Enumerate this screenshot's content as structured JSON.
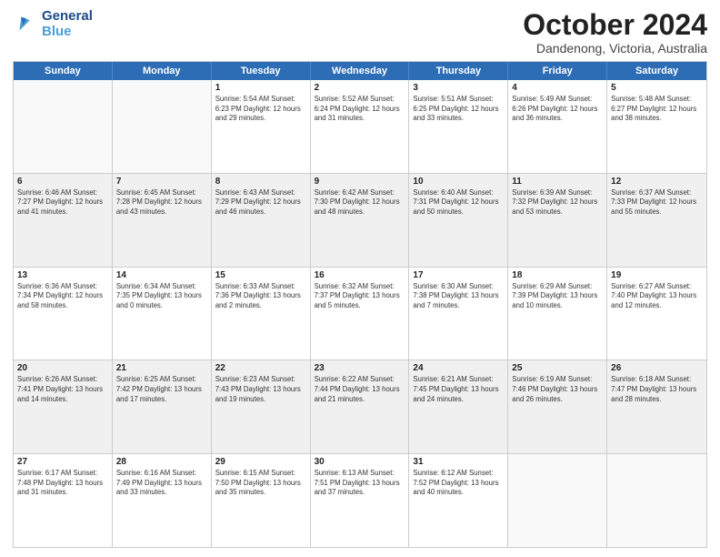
{
  "logo": {
    "line1": "General",
    "line2": "Blue"
  },
  "title": "October 2024",
  "location": "Dandenong, Victoria, Australia",
  "headers": [
    "Sunday",
    "Monday",
    "Tuesday",
    "Wednesday",
    "Thursday",
    "Friday",
    "Saturday"
  ],
  "rows": [
    [
      {
        "day": "",
        "detail": "",
        "empty": true
      },
      {
        "day": "",
        "detail": "",
        "empty": true
      },
      {
        "day": "1",
        "detail": "Sunrise: 5:54 AM\nSunset: 6:23 PM\nDaylight: 12 hours\nand 29 minutes."
      },
      {
        "day": "2",
        "detail": "Sunrise: 5:52 AM\nSunset: 6:24 PM\nDaylight: 12 hours\nand 31 minutes."
      },
      {
        "day": "3",
        "detail": "Sunrise: 5:51 AM\nSunset: 6:25 PM\nDaylight: 12 hours\nand 33 minutes."
      },
      {
        "day": "4",
        "detail": "Sunrise: 5:49 AM\nSunset: 6:26 PM\nDaylight: 12 hours\nand 36 minutes."
      },
      {
        "day": "5",
        "detail": "Sunrise: 5:48 AM\nSunset: 6:27 PM\nDaylight: 12 hours\nand 38 minutes."
      }
    ],
    [
      {
        "day": "6",
        "detail": "Sunrise: 6:46 AM\nSunset: 7:27 PM\nDaylight: 12 hours\nand 41 minutes."
      },
      {
        "day": "7",
        "detail": "Sunrise: 6:45 AM\nSunset: 7:28 PM\nDaylight: 12 hours\nand 43 minutes."
      },
      {
        "day": "8",
        "detail": "Sunrise: 6:43 AM\nSunset: 7:29 PM\nDaylight: 12 hours\nand 46 minutes."
      },
      {
        "day": "9",
        "detail": "Sunrise: 6:42 AM\nSunset: 7:30 PM\nDaylight: 12 hours\nand 48 minutes."
      },
      {
        "day": "10",
        "detail": "Sunrise: 6:40 AM\nSunset: 7:31 PM\nDaylight: 12 hours\nand 50 minutes."
      },
      {
        "day": "11",
        "detail": "Sunrise: 6:39 AM\nSunset: 7:32 PM\nDaylight: 12 hours\nand 53 minutes."
      },
      {
        "day": "12",
        "detail": "Sunrise: 6:37 AM\nSunset: 7:33 PM\nDaylight: 12 hours\nand 55 minutes."
      }
    ],
    [
      {
        "day": "13",
        "detail": "Sunrise: 6:36 AM\nSunset: 7:34 PM\nDaylight: 12 hours\nand 58 minutes."
      },
      {
        "day": "14",
        "detail": "Sunrise: 6:34 AM\nSunset: 7:35 PM\nDaylight: 13 hours\nand 0 minutes."
      },
      {
        "day": "15",
        "detail": "Sunrise: 6:33 AM\nSunset: 7:36 PM\nDaylight: 13 hours\nand 2 minutes."
      },
      {
        "day": "16",
        "detail": "Sunrise: 6:32 AM\nSunset: 7:37 PM\nDaylight: 13 hours\nand 5 minutes."
      },
      {
        "day": "17",
        "detail": "Sunrise: 6:30 AM\nSunset: 7:38 PM\nDaylight: 13 hours\nand 7 minutes."
      },
      {
        "day": "18",
        "detail": "Sunrise: 6:29 AM\nSunset: 7:39 PM\nDaylight: 13 hours\nand 10 minutes."
      },
      {
        "day": "19",
        "detail": "Sunrise: 6:27 AM\nSunset: 7:40 PM\nDaylight: 13 hours\nand 12 minutes."
      }
    ],
    [
      {
        "day": "20",
        "detail": "Sunrise: 6:26 AM\nSunset: 7:41 PM\nDaylight: 13 hours\nand 14 minutes."
      },
      {
        "day": "21",
        "detail": "Sunrise: 6:25 AM\nSunset: 7:42 PM\nDaylight: 13 hours\nand 17 minutes."
      },
      {
        "day": "22",
        "detail": "Sunrise: 6:23 AM\nSunset: 7:43 PM\nDaylight: 13 hours\nand 19 minutes."
      },
      {
        "day": "23",
        "detail": "Sunrise: 6:22 AM\nSunset: 7:44 PM\nDaylight: 13 hours\nand 21 minutes."
      },
      {
        "day": "24",
        "detail": "Sunrise: 6:21 AM\nSunset: 7:45 PM\nDaylight: 13 hours\nand 24 minutes."
      },
      {
        "day": "25",
        "detail": "Sunrise: 6:19 AM\nSunset: 7:46 PM\nDaylight: 13 hours\nand 26 minutes."
      },
      {
        "day": "26",
        "detail": "Sunrise: 6:18 AM\nSunset: 7:47 PM\nDaylight: 13 hours\nand 28 minutes."
      }
    ],
    [
      {
        "day": "27",
        "detail": "Sunrise: 6:17 AM\nSunset: 7:48 PM\nDaylight: 13 hours\nand 31 minutes."
      },
      {
        "day": "28",
        "detail": "Sunrise: 6:16 AM\nSunset: 7:49 PM\nDaylight: 13 hours\nand 33 minutes."
      },
      {
        "day": "29",
        "detail": "Sunrise: 6:15 AM\nSunset: 7:50 PM\nDaylight: 13 hours\nand 35 minutes."
      },
      {
        "day": "30",
        "detail": "Sunrise: 6:13 AM\nSunset: 7:51 PM\nDaylight: 13 hours\nand 37 minutes."
      },
      {
        "day": "31",
        "detail": "Sunrise: 6:12 AM\nSunset: 7:52 PM\nDaylight: 13 hours\nand 40 minutes."
      },
      {
        "day": "",
        "detail": "",
        "empty": true
      },
      {
        "day": "",
        "detail": "",
        "empty": true
      }
    ]
  ]
}
